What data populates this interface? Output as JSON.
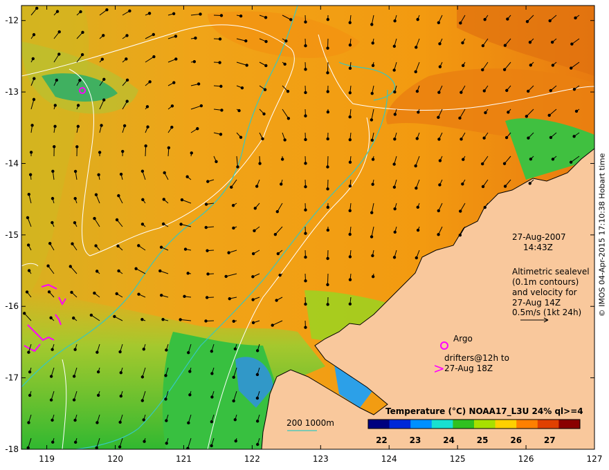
{
  "map": {
    "timestamp_date": "27-Aug-2007",
    "timestamp_time": "14:43Z",
    "altimetry_note": [
      "Altimetric sealevel",
      "(0.1m contours)",
      "and velocity for",
      "27-Aug 14Z"
    ],
    "velocity_scale_label": "0.5m/s (1kt 24h)",
    "argo_label": "Argo",
    "drifters_label": [
      "drifters@12h to",
      "27-Aug 18Z"
    ],
    "depth_contours_label": "200  1000m",
    "credit": "© IMOS 04-Apr-2015 17:10:38 Hobart time",
    "lon_ticks": [
      "119",
      "120",
      "121",
      "122",
      "123",
      "124",
      "125",
      "126",
      "127"
    ],
    "lat_ticks": [
      "-12",
      "-13",
      "-14",
      "-15",
      "-16",
      "-17",
      "-18"
    ],
    "colorbar": {
      "title": "Temperature (°C) NOAA17_L3U 24% ql>=4",
      "ticks": [
        "22",
        "23",
        "24",
        "25",
        "26",
        "27"
      ],
      "colors": [
        "#00007f",
        "#0028d8",
        "#0090ff",
        "#18e0d0",
        "#30c020",
        "#a8e000",
        "#ffd000",
        "#ff8000",
        "#e04000",
        "#8a0000"
      ]
    },
    "colors": {
      "land": "#f9c89c",
      "warm_water": "#f0a410",
      "cool_water": "#c8c830",
      "green_water": "#40c040",
      "blue_water": "#3090e0",
      "contour_white": "#ffffff",
      "isobath": "#36c8c0",
      "drifter": "#ff00ff"
    }
  }
}
